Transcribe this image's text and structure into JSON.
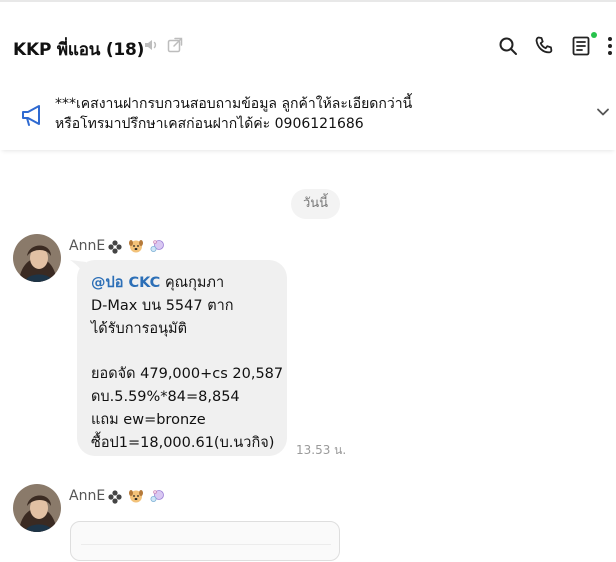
{
  "header": {
    "title": "KKP พี่แอน (18)",
    "icons": [
      "mute-icon",
      "popout-icon",
      "search-icon",
      "phone-icon",
      "notes-icon",
      "more-icon"
    ],
    "online_color": "#27c24c"
  },
  "announcement": {
    "icon": "megaphone-icon",
    "line1": "***เคสงานฝากรบกวนสอบถามข้อมูล ลูกค้าให้ละเอียดกว่านี้",
    "line2": "หรือโทรมาปรึกษาเคสก่อนฝากได้ค่ะ 0906121686"
  },
  "date_divider": "วันนี้",
  "messages": [
    {
      "sender": "AnnE",
      "sender_emojis": [
        "flower-emoji",
        "dog-emoji",
        "bubbles-emoji"
      ],
      "mention": "@ปอ CKC",
      "lines": [
        "คุณกุมภา",
        "D-Max บน 5547 ตาก",
        "ได้รับการอนุมัติ",
        "",
        "ยอดจัด 479,000+cs 20,587",
        "ดบ.5.59%*84=8,854",
        "แถม ew=bronze",
        "ซื้อป1=18,000.61(บ.นวกิจ)"
      ],
      "time": "13.53 น."
    },
    {
      "sender": "AnnE",
      "sender_emojis": [
        "flower-emoji",
        "dog-emoji",
        "bubbles-emoji"
      ]
    }
  ],
  "colors": {
    "mention": "#2c6fb7",
    "bubble": "#f0f0f0",
    "announce_icon": "#2f6ad1"
  }
}
